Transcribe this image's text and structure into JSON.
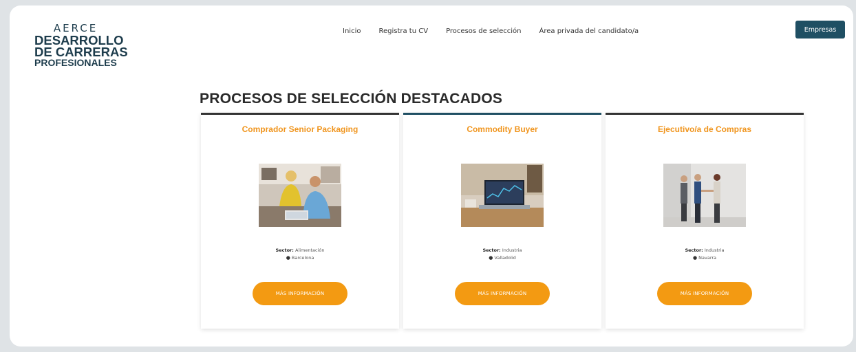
{
  "header": {
    "logo": {
      "brand": "AERCE",
      "line1": "DESARROLLO",
      "line2": "DE CARRERAS",
      "line3": "PROFESIONALES"
    },
    "nav": [
      {
        "label": "Inicio"
      },
      {
        "label": "Registra tu CV"
      },
      {
        "label": "Procesos de selección"
      },
      {
        "label": "Área privada del candidato/a"
      }
    ],
    "cta": "Empresas"
  },
  "main": {
    "title": "PROCESOS DE SELECCIÓN DESTACADOS",
    "cards": [
      {
        "title": "Comprador Senior Packaging",
        "image": "people-at-laptop-photo",
        "sector_label": "Sector:",
        "sector": "Alimentación",
        "location": "Barcelona",
        "button": "MÁS INFORMACIÓN"
      },
      {
        "title": "Commodity Buyer",
        "image": "laptop-trading-screen-photo",
        "sector_label": "Sector:",
        "sector": "Industria",
        "location": "Valladolid",
        "button": "MÁS INFORMACIÓN"
      },
      {
        "title": "Ejecutivo/a de Compras",
        "image": "business-handshake-photo",
        "sector_label": "Sector:",
        "sector": "Industria",
        "location": "Navarra",
        "button": "MÁS INFORMACIÓN"
      }
    ]
  },
  "colors": {
    "accent_orange": "#f39a12",
    "title_orange": "#f0951e",
    "brand_dark": "#1f4f63",
    "background_outer": "#dfe3e6"
  }
}
